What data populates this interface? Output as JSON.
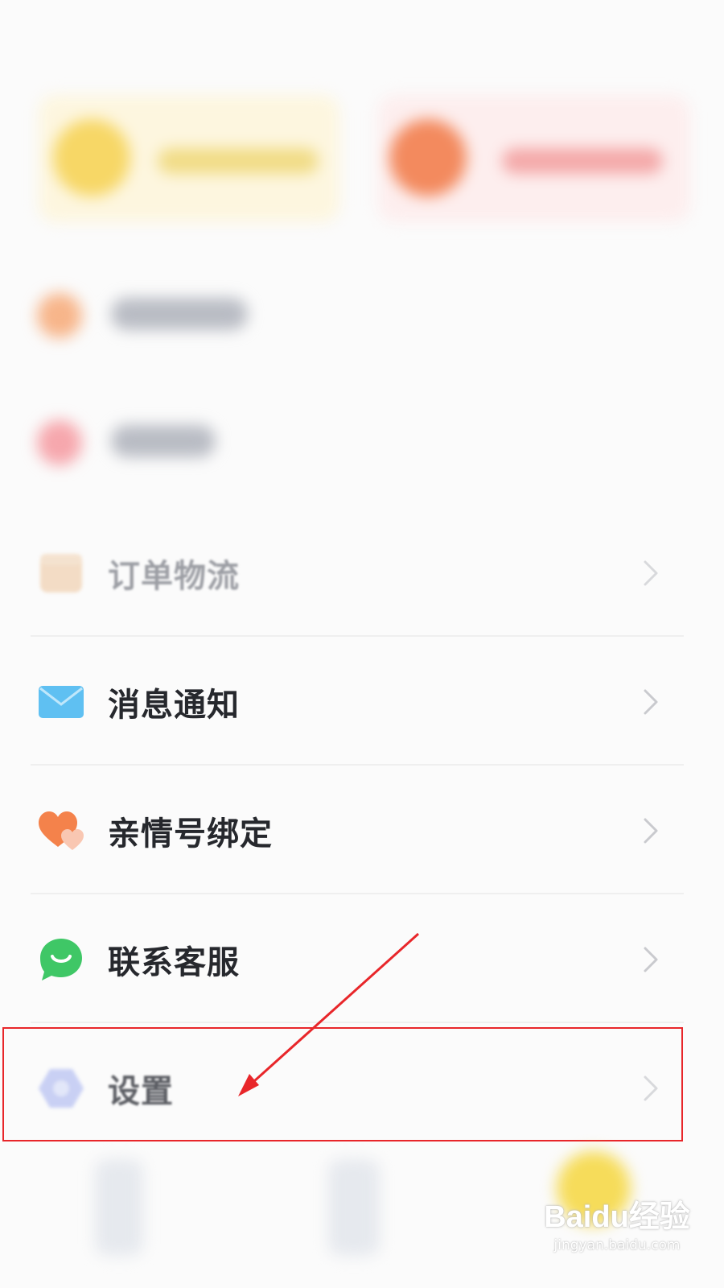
{
  "menu": {
    "items": [
      {
        "label": "订单物流",
        "icon": "package-icon"
      },
      {
        "label": "消息通知",
        "icon": "mail-icon"
      },
      {
        "label": "亲情号绑定",
        "icon": "hearts-icon"
      },
      {
        "label": "联系客服",
        "icon": "chat-icon"
      },
      {
        "label": "设置",
        "icon": "gear-icon"
      }
    ]
  },
  "colors": {
    "highlight": "#e8262a",
    "text": "#26282d",
    "faded_text": "#9c9ea4"
  },
  "watermark": {
    "logo": "Baidu经验",
    "url": "jingyan.baidu.com"
  }
}
